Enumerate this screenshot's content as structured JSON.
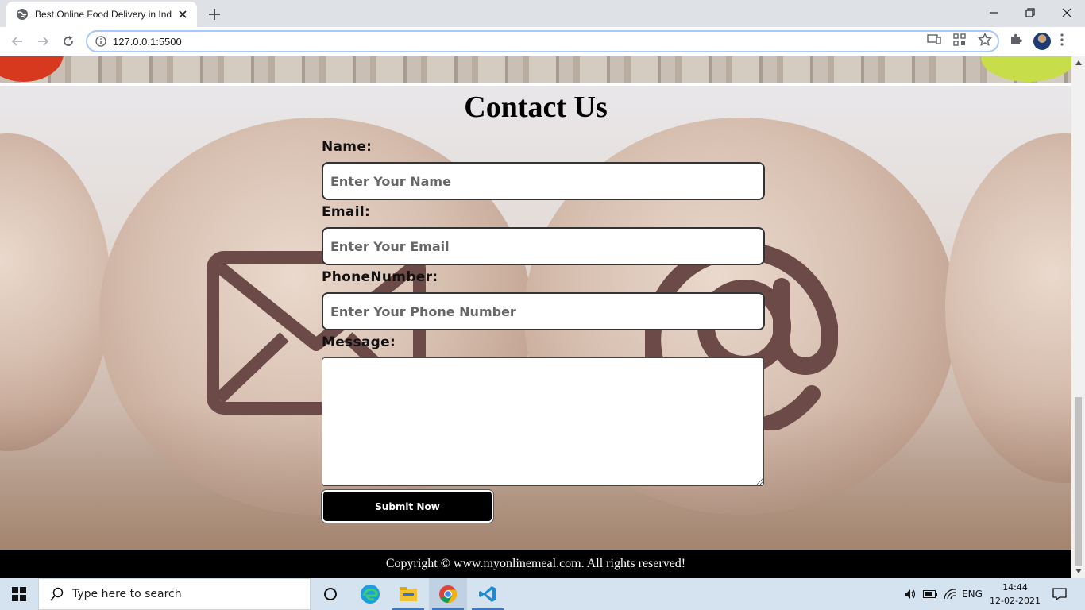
{
  "browser": {
    "tab_title": "Best Online Food Delivery in India",
    "url": "127.0.0.1:5500"
  },
  "page": {
    "heading": "Contact Us",
    "form": {
      "name_label": "Name:",
      "name_placeholder": "Enter Your Name",
      "email_label": "Email:",
      "email_placeholder": "Enter Your Email",
      "phone_label": "PhoneNumber:",
      "phone_placeholder": "Enter Your Phone Number",
      "message_label": "Message:",
      "message_value": "",
      "submit_label": "Submit Now"
    },
    "footer_text": "Copyright © www.myonlinemeal.com. All rights reserved!"
  },
  "taskbar": {
    "search_placeholder": "Type here to search",
    "apps": [
      "task-view",
      "edge",
      "file-explorer",
      "chrome",
      "vscode"
    ],
    "language": "ENG",
    "time": "14:44",
    "date": "12-02-2021"
  },
  "colors": {
    "footer_bg": "#000000",
    "button_bg": "#000000",
    "icon_brown": "#6b4a47",
    "taskbar_bg": "#d5e3f0"
  }
}
